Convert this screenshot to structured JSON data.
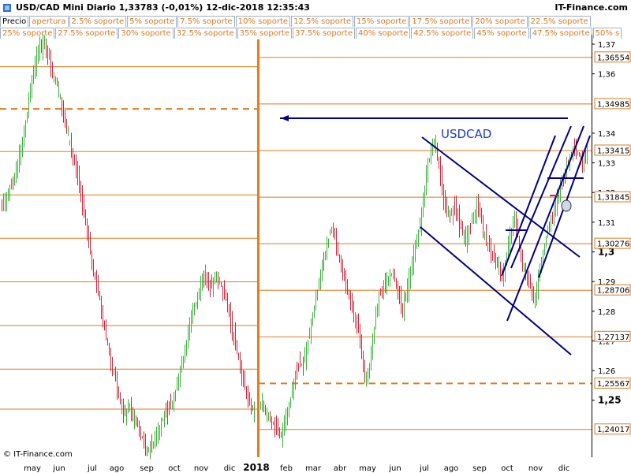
{
  "header": {
    "title": "USD/CAD Mini   Diario   1,33783 (-0,01%)   12-dic-2018 12:35:43",
    "brand": "IT-Finance.com",
    "watermark": "© IT-Finance.com"
  },
  "legend": {
    "row1": [
      "Precio",
      "apertura",
      "2.5% soporte",
      "5% soporte",
      "7.5% soporte",
      "10% soporte",
      "12.5% soporte",
      "15% soporte",
      "17.5% soporte",
      "20% soporte",
      "22.5% soporte"
    ],
    "row2": [
      "25% soporte",
      "27.5% soporte",
      "30% soporte",
      "32.5% soporte",
      "35% soporte",
      "37.5% soporte",
      "40% soporte",
      "42.5% soporte",
      "45% soporte",
      "47.5% soporte",
      "50% s"
    ]
  },
  "chart_data": {
    "type": "ohlc",
    "instrument": "USD/CAD Mini",
    "timeframe": "Diario",
    "last_price": 1.33783,
    "change_pct": "-0,01%",
    "timestamp": "12-dic-2018 12:35:43",
    "annotation": "USDCAD",
    "colors": {
      "up": "#3cb43c",
      "down": "#d2283c",
      "level": "#e07a1f",
      "trend": "#000080",
      "axis": "#000000"
    },
    "panels": [
      {
        "name": "left",
        "ylim": [
          1.2308,
          1.3716
        ],
        "levels": [
          {
            "y": 1.3624,
            "style": "solid"
          },
          {
            "y": 1.3482,
            "style": "dashed"
          },
          {
            "y": 1.3338,
            "style": "solid"
          },
          {
            "y": 1.3192,
            "style": "solid"
          },
          {
            "y": 1.3046,
            "style": "solid"
          },
          {
            "y": 1.2899,
            "style": "solid"
          },
          {
            "y": 1.2752,
            "style": "solid"
          },
          {
            "y": 1.2605,
            "style": "solid"
          },
          {
            "y": 1.247,
            "style": "solid"
          }
        ],
        "x_labels": [
          "may",
          "jun",
          "jul",
          "ago",
          "sep",
          "oct",
          "nov",
          "dic"
        ]
      },
      {
        "name": "right",
        "ylim": [
          1.2308,
          1.3716
        ],
        "levels": [
          {
            "y": 1.36554,
            "style": "solid"
          },
          {
            "y": 1.34985,
            "style": "solid"
          },
          {
            "y": 1.33415,
            "style": "solid"
          },
          {
            "y": 1.31845,
            "style": "solid"
          },
          {
            "y": 1.30276,
            "style": "solid"
          },
          {
            "y": 1.28706,
            "style": "solid"
          },
          {
            "y": 1.27137,
            "style": "solid"
          },
          {
            "y": 1.25567,
            "style": "dashed"
          },
          {
            "y": 1.24017,
            "style": "solid"
          }
        ],
        "x_labels": [
          "2018",
          "feb",
          "mar",
          "abr",
          "may",
          "jun",
          "jul",
          "ago",
          "sep",
          "oct",
          "nov",
          "dic"
        ]
      }
    ],
    "y_ticks": [
      {
        "label": "1,37",
        "value": 1.37
      },
      {
        "label": "1,36",
        "value": 1.36
      },
      {
        "label": "1,34",
        "value": 1.34
      },
      {
        "label": "1,33",
        "value": 1.33
      },
      {
        "label": "1,32",
        "value": 1.32
      },
      {
        "label": "1,31",
        "value": 1.31
      },
      {
        "label": "1,3",
        "value": 1.3
      },
      {
        "label": "1,29",
        "value": 1.29
      },
      {
        "label": "1,28",
        "value": 1.28
      },
      {
        "label": "1,27",
        "value": 1.27
      },
      {
        "label": "1,26",
        "value": 1.26
      },
      {
        "label": "1,25",
        "value": 1.25
      }
    ],
    "y_level_labels": [
      "1,36554",
      "1,34985",
      "1,33415",
      "1,31845",
      "1,30276",
      "1,28706",
      "1,27137",
      "1,25567",
      "1,24017"
    ],
    "left_path": [
      1.313,
      1.318,
      1.322,
      1.326,
      1.332,
      1.34,
      1.352,
      1.362,
      1.368,
      1.37,
      1.366,
      1.36,
      1.355,
      1.348,
      1.34,
      1.333,
      1.326,
      1.318,
      1.308,
      1.298,
      1.29,
      1.282,
      1.272,
      1.264,
      1.257,
      1.25,
      1.245,
      1.248,
      1.244,
      1.24,
      1.236,
      1.233,
      1.236,
      1.24,
      1.244,
      1.246,
      1.25,
      1.255,
      1.262,
      1.27,
      1.278,
      1.284,
      1.29,
      1.292,
      1.288,
      1.291,
      1.289,
      1.285,
      1.278,
      1.27,
      1.262,
      1.255,
      1.25,
      1.246
    ],
    "right_path": [
      1.25,
      1.248,
      1.246,
      1.244,
      1.241,
      1.238,
      1.24,
      1.245,
      1.252,
      1.258,
      1.262,
      1.262,
      1.268,
      1.275,
      1.282,
      1.29,
      1.296,
      1.302,
      1.308,
      1.305,
      1.298,
      1.292,
      1.288,
      1.283,
      1.278,
      1.274,
      1.262,
      1.256,
      1.264,
      1.276,
      1.284,
      1.288,
      1.29,
      1.293,
      1.292,
      1.286,
      1.28,
      1.286,
      1.294,
      1.3,
      1.306,
      1.315,
      1.326,
      1.334,
      1.338,
      1.33,
      1.32,
      1.314,
      1.312,
      1.316,
      1.31,
      1.306,
      1.304,
      1.309,
      1.313,
      1.316,
      1.309,
      1.304,
      1.3,
      1.298,
      1.296,
      1.29,
      1.297,
      1.305,
      1.312,
      1.306,
      1.296,
      1.292,
      1.289,
      1.283,
      1.29,
      1.298,
      1.304,
      1.309,
      1.313,
      1.318,
      1.323,
      1.328,
      1.332,
      1.336,
      1.333,
      1.33,
      1.333
    ]
  }
}
